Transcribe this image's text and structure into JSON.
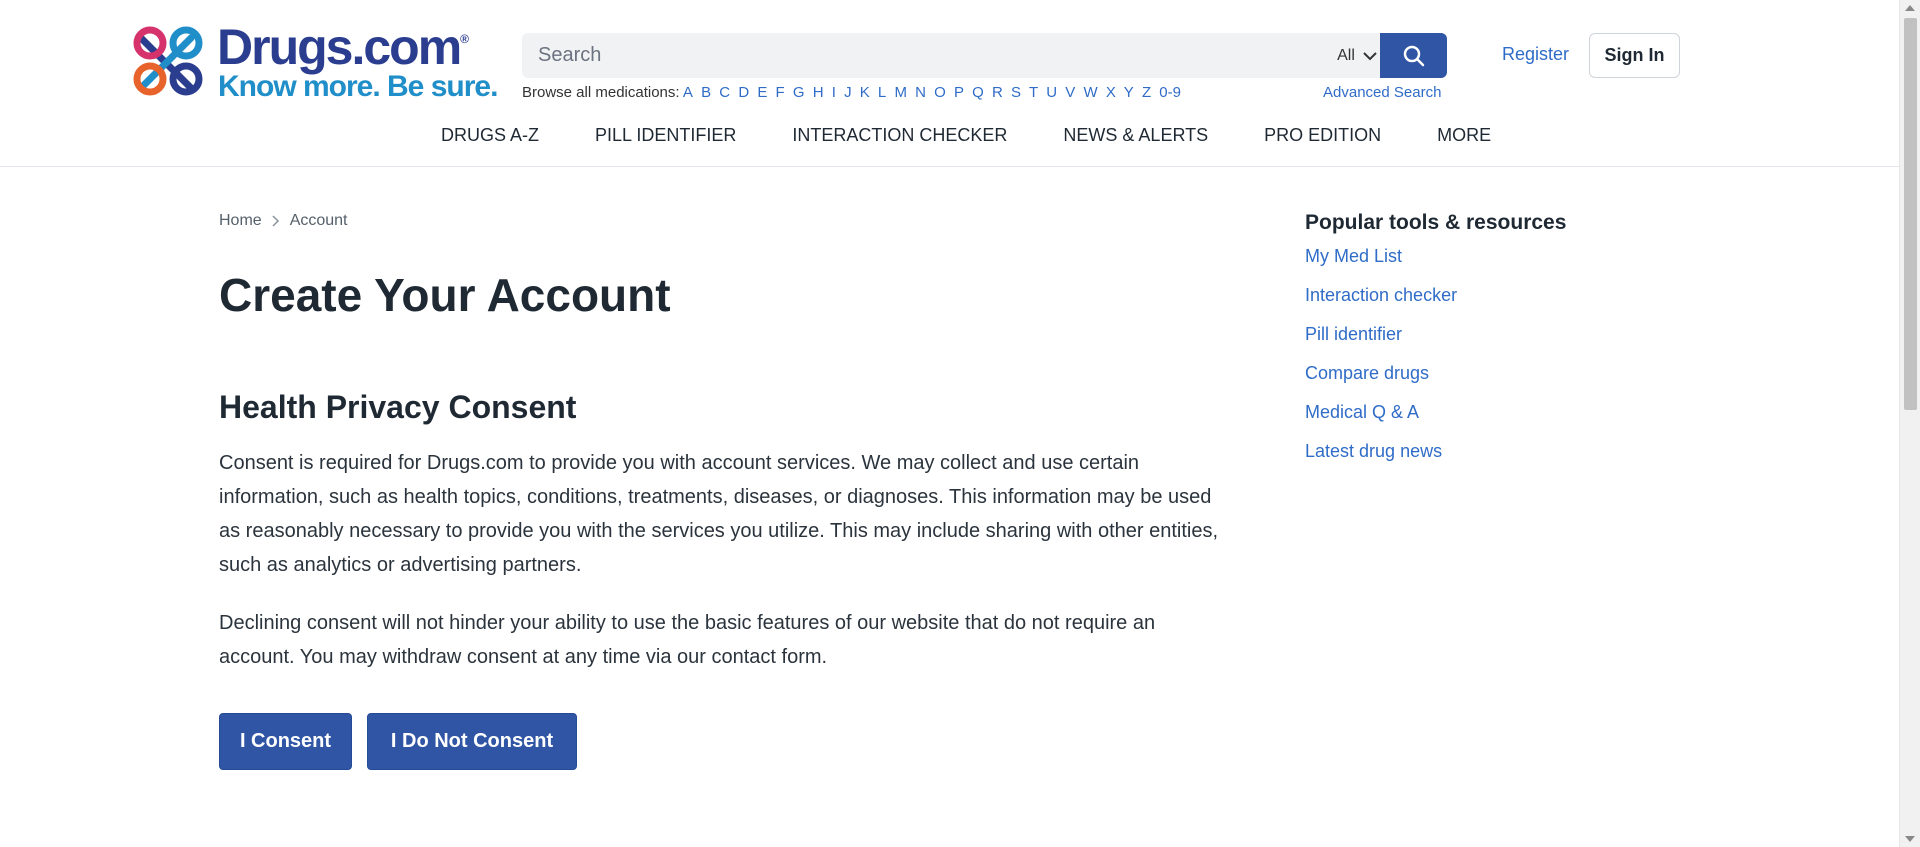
{
  "brand": {
    "name": "Drugs.com",
    "registered_mark": "®",
    "tagline": "Know more. Be sure."
  },
  "search": {
    "placeholder": "Search",
    "filter_label": "All",
    "browse_label": "Browse all medications:",
    "letters": [
      "A",
      "B",
      "C",
      "D",
      "E",
      "F",
      "G",
      "H",
      "I",
      "J",
      "K",
      "L",
      "M",
      "N",
      "O",
      "P",
      "Q",
      "R",
      "S",
      "T",
      "U",
      "V",
      "W",
      "X",
      "Y",
      "Z",
      "0-9"
    ],
    "advanced_label": "Advanced Search"
  },
  "auth": {
    "register_label": "Register",
    "signin_label": "Sign In"
  },
  "nav": {
    "items": [
      "Drugs A-Z",
      "Pill Identifier",
      "Interaction Checker",
      "News & Alerts",
      "Pro Edition",
      "More"
    ]
  },
  "breadcrumb": {
    "home": "Home",
    "current": "Account"
  },
  "main": {
    "title": "Create Your Account",
    "section_title": "Health Privacy Consent",
    "paragraph1": "Consent is required for Drugs.com to provide you with account services. We may collect and use certain information, such as health topics, conditions, treatments, diseases, or diagnoses. This information may be used as reasonably necessary to provide you with the services you utilize. This may include sharing with other entities, such as analytics or advertising partners.",
    "paragraph2": "Declining consent will not hinder your ability to use the basic features of our website that do not require an account. You may withdraw consent at any time via our contact form.",
    "consent_label": "I Consent",
    "decline_label": "I Do Not Consent"
  },
  "sidebar": {
    "title": "Popular tools & resources",
    "links": [
      "My Med List",
      "Interaction checker",
      "Pill identifier",
      "Compare drugs",
      "Medical Q & A",
      "Latest drug news"
    ]
  },
  "colors": {
    "brand_navy": "#2b3d8f",
    "brand_blue": "#1f8ec9",
    "button_blue": "#2f55a4",
    "link_blue": "#2f6cc7"
  },
  "icons": {
    "logo": "drugs-com-logo-mark",
    "search": "search-icon",
    "filter": "chevron-down-icon",
    "breadcrumb_sep": "chevron-right-icon"
  }
}
